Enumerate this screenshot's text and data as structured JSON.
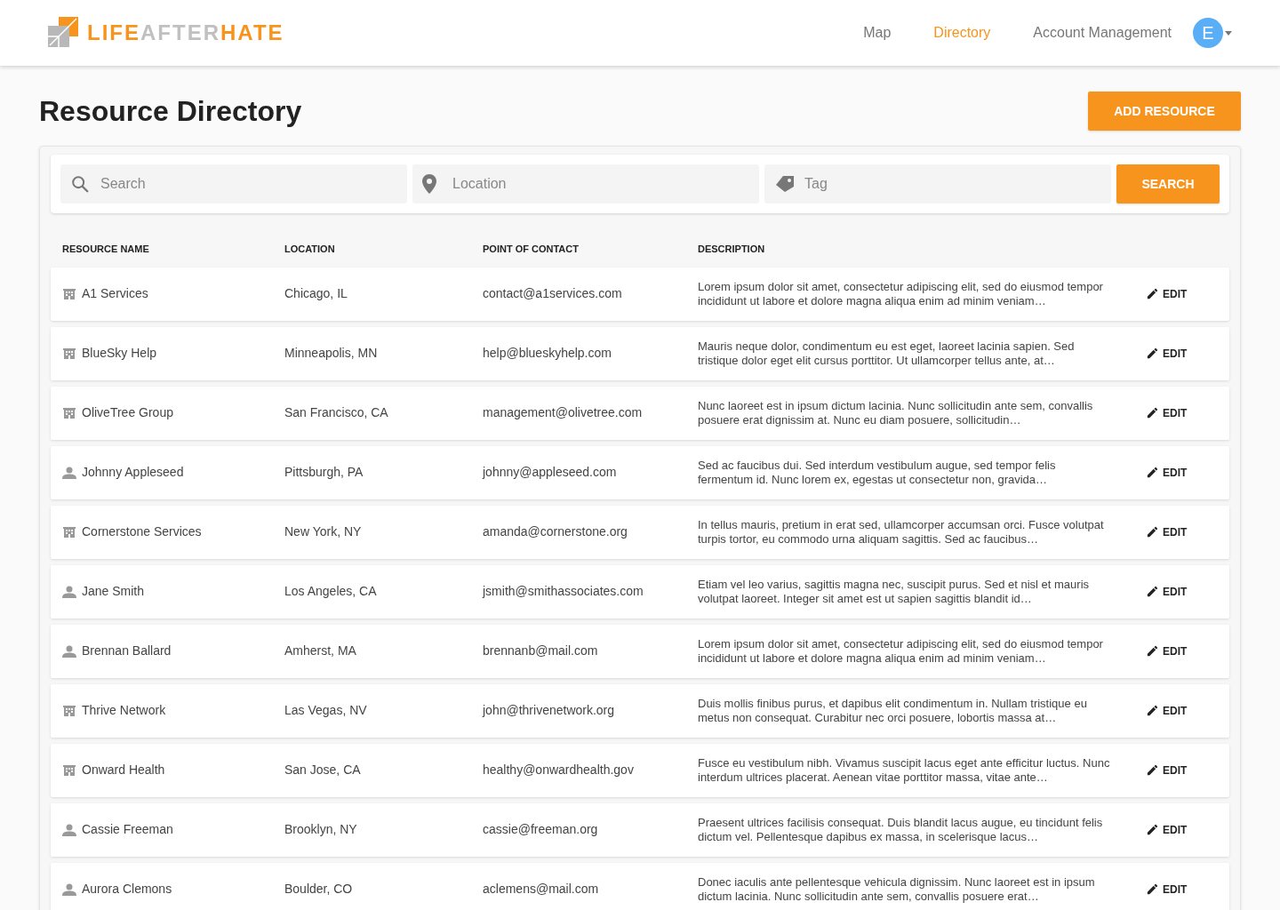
{
  "logo": {
    "parts": [
      {
        "text": "LIFE",
        "kind": "accent"
      },
      {
        "text": "AFTER",
        "kind": "plain"
      },
      {
        "text": "HATE",
        "kind": "accent"
      }
    ]
  },
  "nav": [
    {
      "label": "Map",
      "selected": false
    },
    {
      "label": "Directory",
      "selected": true
    },
    {
      "label": "Account Management",
      "selected": false
    }
  ],
  "user": {
    "initial": "E"
  },
  "page_title": "Resource Directory",
  "add_button": "ADD RESOURCE",
  "filters": [
    {
      "kind": "search",
      "placeholder": "Search"
    },
    {
      "kind": "location",
      "placeholder": "Location"
    },
    {
      "kind": "tag",
      "placeholder": "Tag"
    }
  ],
  "search_button": "SEARCH",
  "table": {
    "columns": [
      "RESOURCE NAME",
      "LOCATION",
      "POINT OF CONTACT",
      "DESCRIPTION"
    ],
    "rows": [
      {
        "kind": "organization",
        "name": "A1 Services",
        "location": "Chicago, IL",
        "contact": "contact@a1services.com",
        "description": "Lorem ipsum dolor sit amet, consectetur adipiscing elit, sed do eiusmod tempor incididunt ut labore et dolore magna aliqua enim ad minim veniam…",
        "action": "EDIT"
      },
      {
        "kind": "organization",
        "name": "BlueSky Help",
        "location": "Minneapolis, MN",
        "contact": "help@blueskyhelp.com",
        "description": "Mauris neque dolor, condimentum eu est eget, laoreet lacinia sapien. Sed tristique dolor eget elit cursus porttitor. Ut ullamcorper tellus ante, at…",
        "action": "EDIT"
      },
      {
        "kind": "organization",
        "name": "OliveTree Group",
        "location": "San Francisco, CA",
        "contact": "management@olivetree.com",
        "description": "Nunc laoreet est in ipsum dictum lacinia. Nunc sollicitudin ante sem, convallis posuere erat dignissim at. Nunc eu diam posuere, sollicitudin…",
        "action": "EDIT"
      },
      {
        "kind": "person",
        "name": "Johnny Appleseed",
        "location": "Pittsburgh, PA",
        "contact": "johnny@appleseed.com",
        "description": "Sed ac faucibus dui. Sed interdum vestibulum augue, sed tempor felis fermentum id. Nunc lorem ex, egestas ut consectetur non, gravida…",
        "action": "EDIT"
      },
      {
        "kind": "organization",
        "name": "Cornerstone Services",
        "location": "New York, NY",
        "contact": "amanda@cornerstone.org",
        "description": "In tellus mauris, pretium in erat sed, ullamcorper accumsan orci. Fusce volutpat turpis tortor, eu commodo urna aliquam sagittis. Sed ac faucibus…",
        "action": "EDIT"
      },
      {
        "kind": "person",
        "name": "Jane Smith",
        "location": "Los Angeles, CA",
        "contact": "jsmith@smithassociates.com",
        "description": "Etiam vel leo varius, sagittis magna nec, suscipit purus. Sed et nisl et mauris volutpat laoreet. Integer sit amet est ut sapien sagittis blandit id…",
        "action": "EDIT"
      },
      {
        "kind": "person",
        "name": "Brennan Ballard",
        "location": "Amherst, MA",
        "contact": "brennanb@mail.com",
        "description": "Lorem ipsum dolor sit amet, consectetur adipiscing elit, sed do eiusmod tempor incididunt ut labore et dolore magna aliqua enim ad minim veniam…",
        "action": "EDIT"
      },
      {
        "kind": "organization",
        "name": "Thrive Network",
        "location": "Las Vegas, NV",
        "contact": "john@thrivenetwork.org",
        "description": "Duis mollis finibus purus, et dapibus elit condimentum in. Nullam tristique eu metus non consequat. Curabitur nec orci posuere, lobortis massa at…",
        "action": "EDIT"
      },
      {
        "kind": "organization",
        "name": "Onward Health",
        "location": "San Jose, CA",
        "contact": "healthy@onwardhealth.gov",
        "description": "Fusce eu vestibulum nibh. Vivamus suscipit lacus eget ante efficitur luctus. Nunc interdum ultrices placerat. Aenean vitae porttitor massa, vitae ante…",
        "action": "EDIT"
      },
      {
        "kind": "person",
        "name": "Cassie Freeman",
        "location": "Brooklyn, NY",
        "contact": "cassie@freeman.org",
        "description": "Praesent ultrices facilisis consequat. Duis blandit lacus augue, eu tincidunt felis dictum vel. Pellentesque dapibus ex massa, in scelerisque lacus…",
        "action": "EDIT"
      },
      {
        "kind": "person",
        "name": "Aurora Clemons",
        "location": "Boulder, CO",
        "contact": "aclemens@mail.com",
        "description": "Donec iaculis ante pellentesque vehicula dignissim. Nunc laoreet est in ipsum dictum lacinia. Nunc sollicitudin ante sem, convallis posuere erat…",
        "action": "EDIT"
      }
    ]
  }
}
